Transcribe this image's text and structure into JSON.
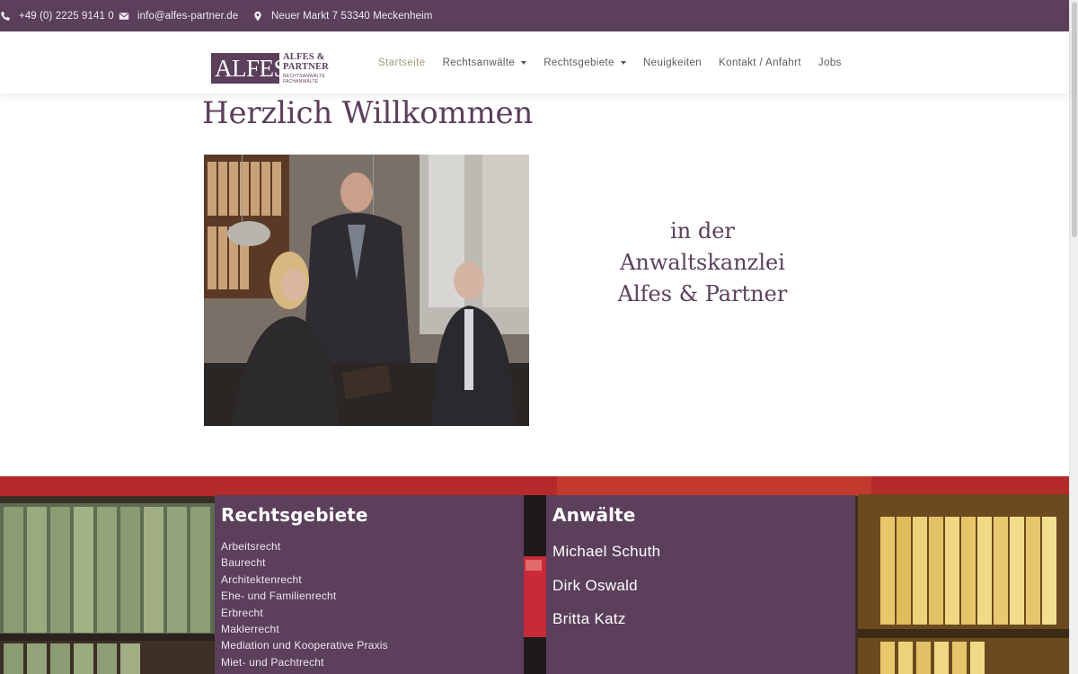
{
  "topbar": {
    "phone": "+49 (0) 2225 9141 0",
    "email": "info@alfes-partner.de",
    "address": "Neuer Markt 7 53340 Meckenheim"
  },
  "logo": {
    "main": "ALFES",
    "line1": "ALFES & PARTNER",
    "line2": "RECHTSANWÄLTE  FACHANWÄLTE"
  },
  "nav": {
    "items": [
      {
        "label": "Startseite"
      },
      {
        "label": "Rechtsanwälte"
      },
      {
        "label": "Rechtsgebiete"
      },
      {
        "label": "Neuigkeiten"
      },
      {
        "label": "Kontakt / Anfahrt"
      },
      {
        "label": "Jobs"
      }
    ]
  },
  "welcome": {
    "title": "Herzlich Willkommen",
    "tagline_1": "in der",
    "tagline_2": "Anwaltskanzlei",
    "tagline_3": "Alfes & Partner"
  },
  "rechtsgebiete": {
    "heading": "Rechtsgebiete",
    "items": [
      "Arbeitsrecht",
      "Baurecht",
      "Architektenrecht",
      "Ehe- und Familienrecht",
      "Erbrecht",
      "Maklerrecht",
      "Mediation und Kooperative Praxis",
      "Miet- und Pachtrecht"
    ]
  },
  "anwaelte": {
    "heading": "Anwälte",
    "items": [
      "Michael Schuth",
      "Dirk Oswald",
      "Britta Katz"
    ]
  },
  "colors": {
    "brand": "#5b3f5b",
    "nav_active": "#a09a7a"
  }
}
